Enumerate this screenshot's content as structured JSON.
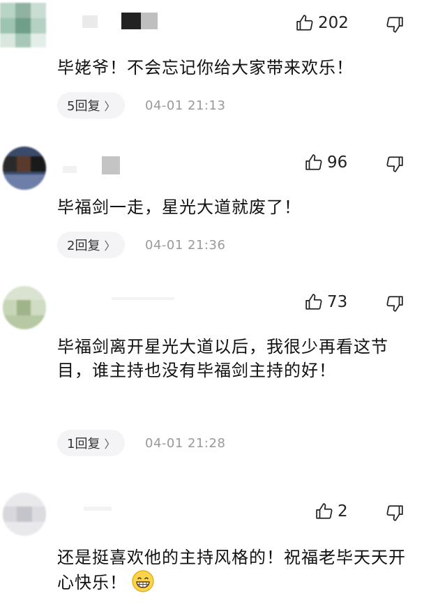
{
  "comments": [
    {
      "likes": "202",
      "text": "毕姥爷！不会忘记你给大家带来欢乐！",
      "reply_count": "5回复",
      "chevron": "〉",
      "time": "04-01 21:13"
    },
    {
      "likes": "96",
      "text": "毕福剑一走，星光大道就废了！",
      "reply_count": "2回复",
      "chevron": "〉",
      "time": "04-01 21:36"
    },
    {
      "likes": "73",
      "text": "毕福剑离开星光大道以后，我很少再看这节目，谁主持也没有毕福剑主持的好！",
      "reply_count": "1回复",
      "chevron": "〉",
      "time": "04-01 21:28"
    },
    {
      "likes": "2",
      "text": "还是挺喜欢他的主持风格的！祝福老毕天天开心快乐！",
      "emoji": "grinning-face-icon"
    }
  ],
  "icons": {
    "like": "thumb-up-icon",
    "dislike": "thumb-down-icon"
  }
}
